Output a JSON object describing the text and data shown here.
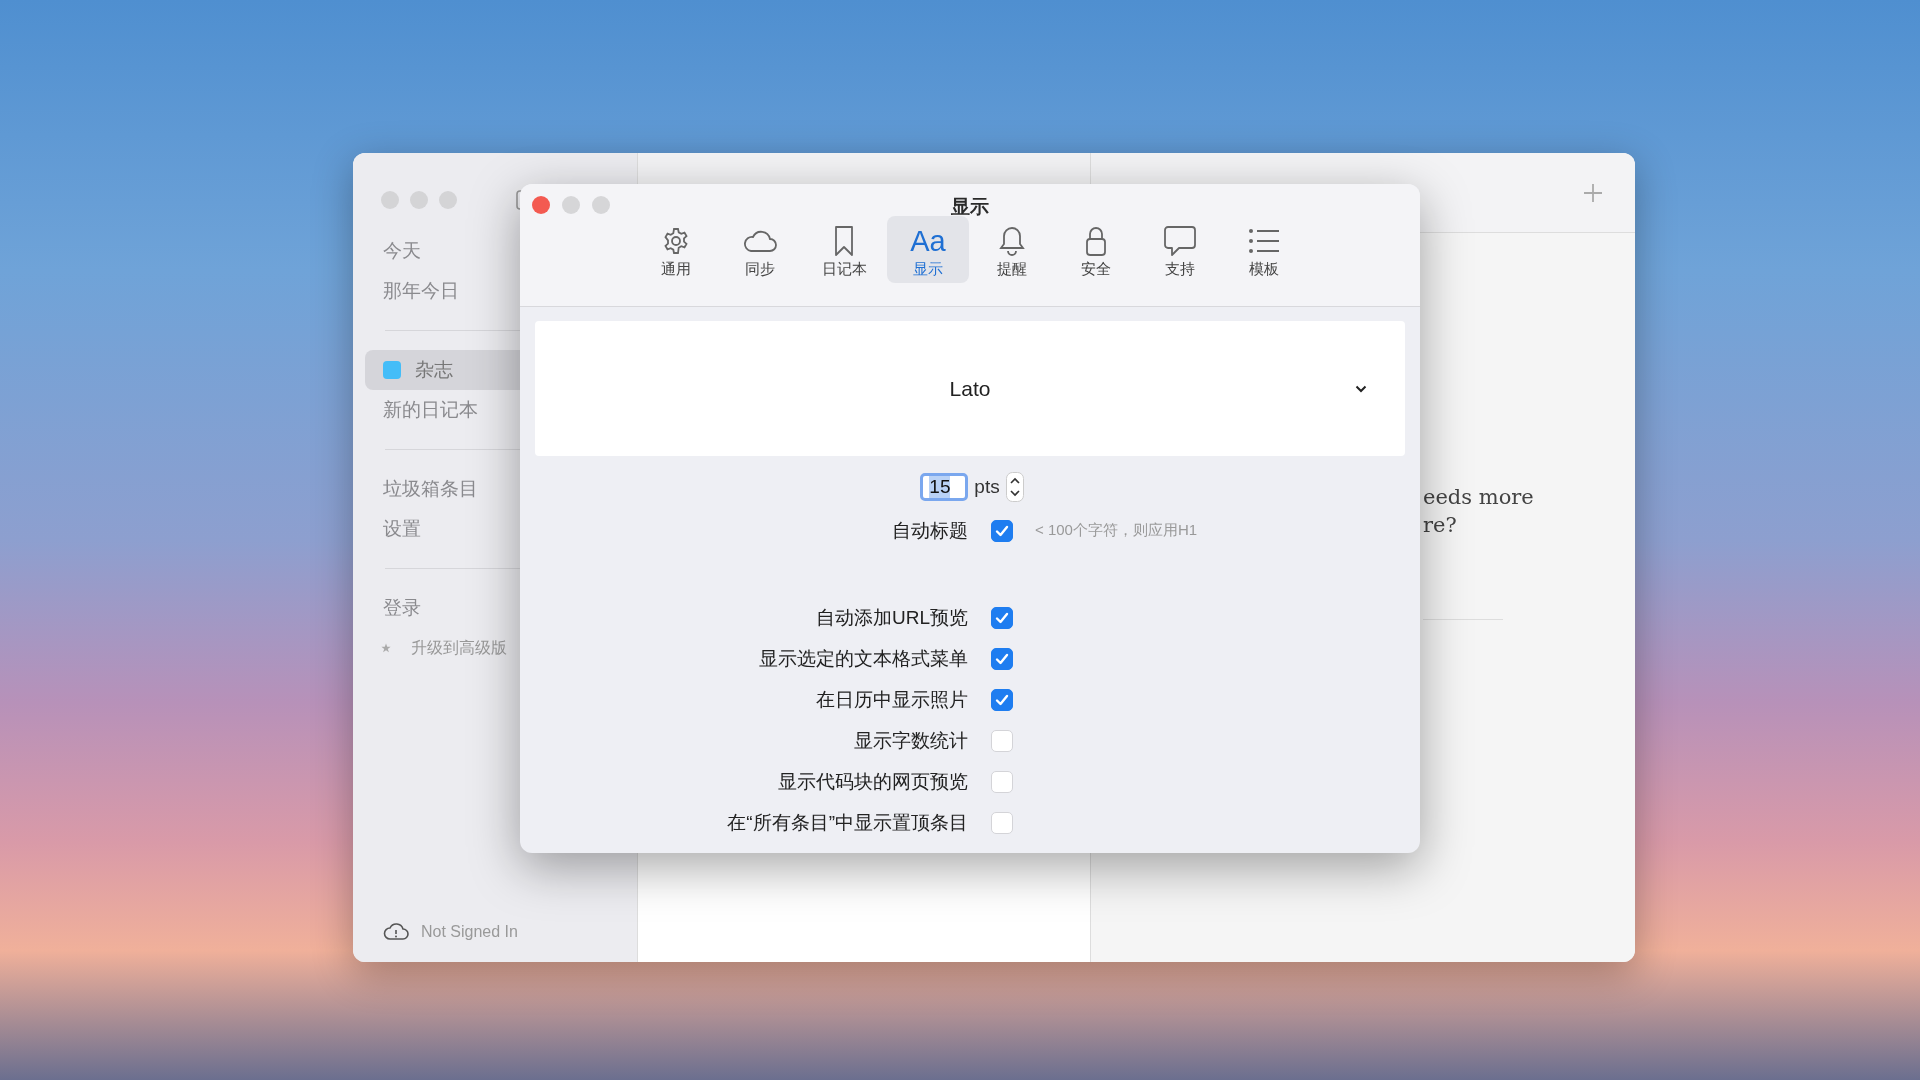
{
  "main_window": {
    "sidebar": {
      "sections": [
        {
          "items": [
            {
              "label": "今天",
              "kind": "plain",
              "selected": false
            },
            {
              "label": "那年今日",
              "kind": "plain",
              "selected": false
            }
          ]
        },
        {
          "items": [
            {
              "label": "杂志",
              "kind": "journal",
              "color": "#44bdf8",
              "selected": true
            },
            {
              "label": "新的日记本",
              "kind": "plain",
              "selected": false
            }
          ]
        },
        {
          "items": [
            {
              "label": "垃圾箱条目",
              "kind": "plain",
              "selected": false
            },
            {
              "label": "设置",
              "kind": "plain",
              "selected": false
            }
          ]
        },
        {
          "items": [
            {
              "label": "登录",
              "kind": "plain",
              "selected": false
            },
            {
              "label": "升级到高级版",
              "kind": "upgrade"
            }
          ]
        }
      ]
    },
    "account_status": "Not Signed In",
    "entry_preview": {
      "lines": [
        "eeds more",
        "re?"
      ]
    }
  },
  "preferences": {
    "title": "显示",
    "tabs": [
      {
        "label": "通用",
        "kind": "gear",
        "selected": false
      },
      {
        "label": "同步",
        "kind": "cloud",
        "selected": false
      },
      {
        "label": "日记本",
        "kind": "bookmark",
        "selected": false
      },
      {
        "label": "显示",
        "kind": "text",
        "glyph": "Aa",
        "selected": true
      },
      {
        "label": "提醒",
        "kind": "bell",
        "selected": false
      },
      {
        "label": "安全",
        "kind": "lock",
        "selected": false
      },
      {
        "label": "支持",
        "kind": "bubble",
        "selected": false
      },
      {
        "label": "模板",
        "kind": "list",
        "selected": false
      }
    ],
    "font": {
      "value": "Lato"
    },
    "font_size": {
      "value": "15",
      "unit": "pts"
    },
    "options": [
      {
        "label": "自动标题",
        "checked": true,
        "hint": "< 100个字符，则应用H1"
      },
      {
        "label": "自动添加URL预览",
        "checked": true
      },
      {
        "label": "显示选定的文本格式菜单",
        "checked": true
      },
      {
        "label": "在日历中显示照片",
        "checked": true
      },
      {
        "label": "显示字数统计",
        "checked": false
      },
      {
        "label": "显示代码块的网页预览",
        "checked": false
      },
      {
        "label": "在“所有条目”中显示置顶条目",
        "checked": false
      }
    ]
  }
}
